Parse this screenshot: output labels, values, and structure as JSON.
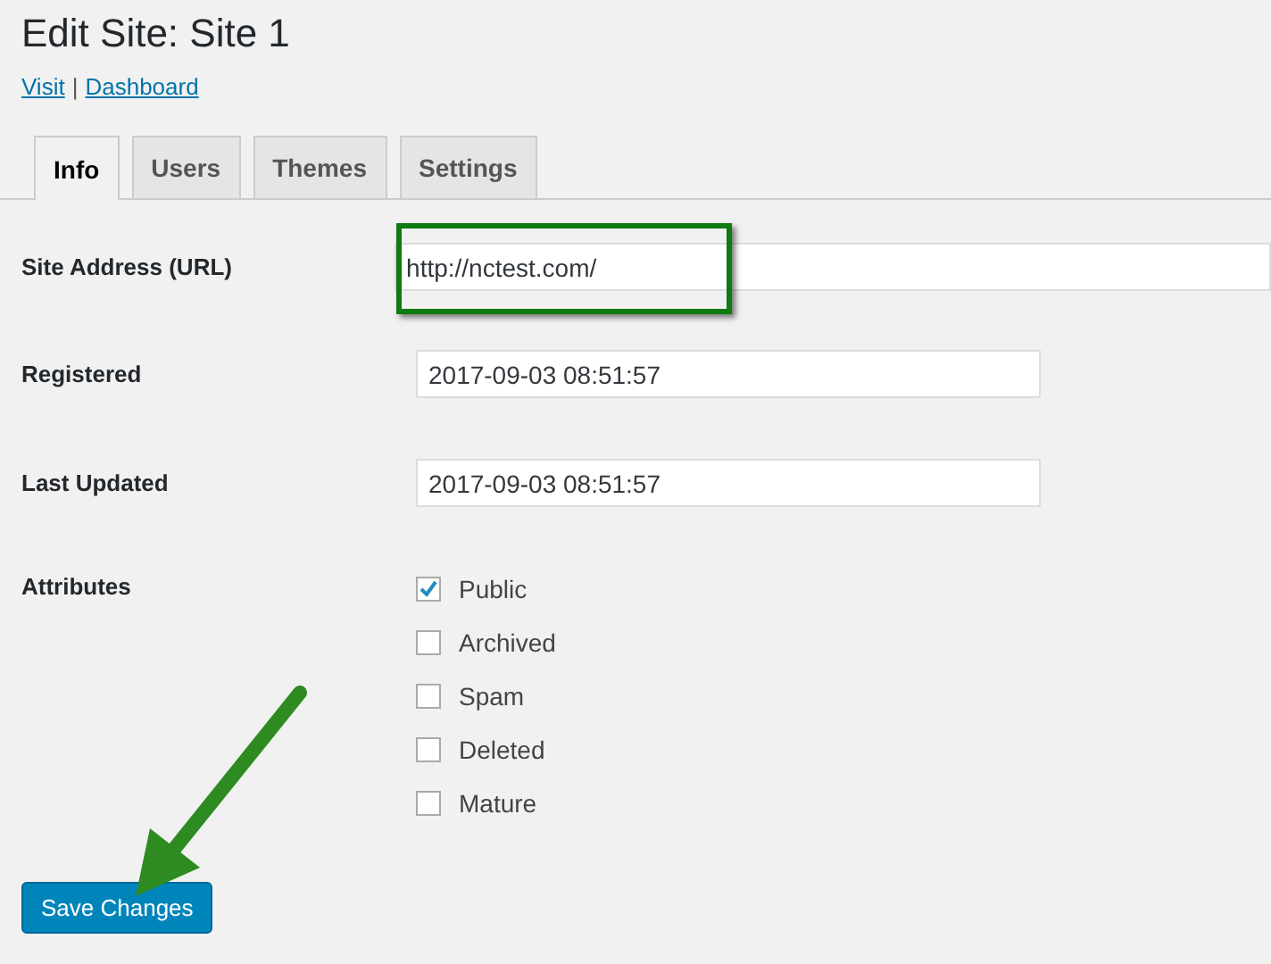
{
  "page": {
    "title": "Edit Site: Site 1"
  },
  "links": [
    {
      "label": "Visit"
    },
    {
      "label": "Dashboard"
    }
  ],
  "separator": "|",
  "tabs": [
    {
      "label": "Info",
      "selected": true
    },
    {
      "label": "Users",
      "selected": false
    },
    {
      "label": "Themes",
      "selected": false
    },
    {
      "label": "Settings",
      "selected": false
    }
  ],
  "fields": [
    {
      "label": "Site Address (URL)",
      "value": "http://nctest.com/",
      "kind": "wide"
    },
    {
      "label": "Registered",
      "value": "2017-09-03 08:51:57",
      "kind": "normal"
    },
    {
      "label": "Last Updated",
      "value": "2017-09-03 08:51:57",
      "kind": "normal"
    }
  ],
  "attributes": {
    "label": "Attributes",
    "options": [
      {
        "label": "Public",
        "checked": true
      },
      {
        "label": "Archived",
        "checked": false
      },
      {
        "label": "Spam",
        "checked": false
      },
      {
        "label": "Deleted",
        "checked": false
      },
      {
        "label": "Mature",
        "checked": false
      }
    ]
  },
  "save_button": {
    "label": "Save Changes"
  },
  "annotations": {
    "highlight_frame": true,
    "arrow": true
  }
}
